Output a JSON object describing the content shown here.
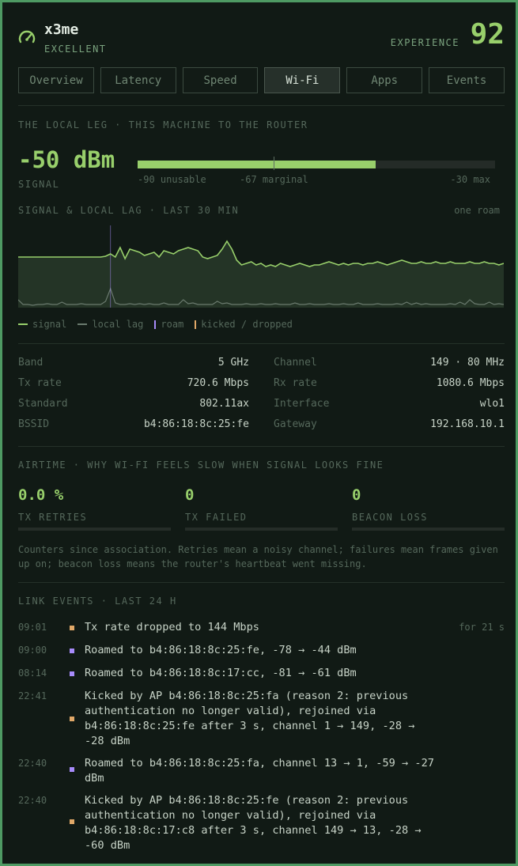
{
  "header": {
    "host": "x3me",
    "status": "EXCELLENT",
    "experience_label": "EXPERIENCE",
    "experience_score": "92",
    "icon": "gauge-icon"
  },
  "tabs": [
    {
      "label": "Overview",
      "active": false
    },
    {
      "label": "Latency",
      "active": false
    },
    {
      "label": "Speed",
      "active": false
    },
    {
      "label": "Wi-Fi",
      "active": true
    },
    {
      "label": "Apps",
      "active": false
    },
    {
      "label": "Events",
      "active": false
    }
  ],
  "signal": {
    "section_title": "THE LOCAL LEG · THIS MACHINE TO THE ROUTER",
    "value": "-50 dBm",
    "label": "SIGNAL",
    "level_dbm": -50,
    "scale_min_dbm": -90,
    "scale_max_dbm": -30,
    "marginal_dbm": -67,
    "scale_labels": {
      "min": "-90 unusable",
      "mid": "-67 marginal",
      "max": "-30 max"
    }
  },
  "chart": {
    "title": "SIGNAL & LOCAL LAG · LAST 30 MIN",
    "note": "one roam",
    "legend": {
      "signal": "signal",
      "lag": "local lag",
      "roam": "roam",
      "kicked": "kicked / dropped"
    },
    "colors": {
      "signal": "#98cf6b",
      "lag": "#6a7a6e",
      "roam": "#a78bfa",
      "kicked": "#e0a868"
    }
  },
  "chart_data": {
    "type": "area",
    "series": [
      {
        "name": "signal",
        "values": [
          60,
          60,
          60,
          60,
          60,
          60,
          60,
          60,
          60,
          60,
          60,
          60,
          60,
          60,
          60,
          60,
          60,
          60,
          61,
          64,
          60,
          72,
          58,
          70,
          68,
          66,
          62,
          64,
          66,
          60,
          68,
          66,
          64,
          68,
          70,
          72,
          70,
          68,
          60,
          58,
          60,
          62,
          70,
          80,
          70,
          56,
          50,
          52,
          54,
          50,
          52,
          48,
          50,
          48,
          52,
          50,
          48,
          50,
          52,
          50,
          48,
          50,
          50,
          52,
          54,
          52,
          50,
          52,
          50,
          52,
          52,
          50,
          52,
          52,
          54,
          52,
          50,
          52,
          54,
          56,
          54,
          52,
          52,
          54,
          52,
          52,
          54,
          52,
          52,
          54,
          52,
          52,
          52,
          54,
          52,
          52,
          54,
          52,
          52,
          50,
          52
        ]
      },
      {
        "name": "local lag",
        "values": [
          8,
          2,
          2,
          1,
          2,
          2,
          3,
          2,
          2,
          5,
          2,
          2,
          2,
          3,
          2,
          2,
          2,
          2,
          6,
          22,
          4,
          2,
          2,
          3,
          2,
          3,
          2,
          3,
          2,
          2,
          4,
          2,
          2,
          2,
          8,
          3,
          4,
          2,
          2,
          2,
          2,
          6,
          3,
          4,
          2,
          2,
          2,
          3,
          2,
          2,
          3,
          2,
          2,
          3,
          2,
          2,
          2,
          4,
          2,
          2,
          3,
          2,
          2,
          2,
          3,
          2,
          2,
          3,
          2,
          2,
          4,
          2,
          2,
          2,
          3,
          2,
          2,
          2,
          3,
          2,
          5,
          2,
          4,
          2,
          3,
          2,
          2,
          2,
          2,
          3,
          2,
          5,
          2,
          8,
          3,
          2,
          2,
          5,
          2,
          3,
          2
        ]
      }
    ],
    "roam_markers": [
      19
    ],
    "ylim": [
      -90,
      -30
    ]
  },
  "stats": {
    "rows": [
      {
        "k1": "Band",
        "v1": "5 GHz",
        "k2": "Channel",
        "v2": "149 · 80 MHz"
      },
      {
        "k1": "Tx rate",
        "v1": "720.6 Mbps",
        "k2": "Rx rate",
        "v2": "1080.6 Mbps"
      },
      {
        "k1": "Standard",
        "v1": "802.11ax",
        "k2": "Interface",
        "v2": "wlo1"
      },
      {
        "k1": "BSSID",
        "v1": "b4:86:18:8c:25:fe",
        "k2": "Gateway",
        "v2": "192.168.10.1"
      }
    ]
  },
  "airtime": {
    "title": "AIRTIME · WHY WI-FI FEELS SLOW WHEN SIGNAL LOOKS FINE",
    "items": [
      {
        "value": "0.0 %",
        "label": "TX RETRIES",
        "fill": 0
      },
      {
        "value": "0",
        "label": "TX FAILED",
        "fill": 0
      },
      {
        "value": "0",
        "label": "BEACON LOSS",
        "fill": 0
      }
    ],
    "note": "Counters since association. Retries mean a noisy channel; failures mean frames given up on; beacon loss means the router's heartbeat went missing."
  },
  "events": {
    "title": "LINK EVENTS · LAST 24 H",
    "items": [
      {
        "time": "09:01",
        "kind": "kicked",
        "text": "Tx rate dropped to 144 Mbps",
        "extra": "for 21 s"
      },
      {
        "time": "09:00",
        "kind": "roam",
        "text": "Roamed to b4:86:18:8c:25:fe, -78 → -44 dBm",
        "extra": ""
      },
      {
        "time": "08:14",
        "kind": "roam",
        "text": "Roamed to b4:86:18:8c:17:cc, -81 → -61 dBm",
        "extra": ""
      },
      {
        "time": "22:41",
        "kind": "kicked",
        "text": "Kicked by AP b4:86:18:8c:25:fa (reason 2: previous authentication no longer valid), rejoined via b4:86:18:8c:25:fe after 3 s, channel 1 → 149, -28 → -28 dBm",
        "extra": ""
      },
      {
        "time": "22:40",
        "kind": "roam",
        "text": "Roamed to b4:86:18:8c:25:fa, channel 13 → 1, -59 → -27 dBm",
        "extra": ""
      },
      {
        "time": "22:40",
        "kind": "kicked",
        "text": "Kicked by AP b4:86:18:8c:25:fe (reason 2: previous authentication no longer valid), rejoined via b4:86:18:8c:17:c8 after 3 s, channel 149 → 13, -28 → -60 dBm",
        "extra": ""
      }
    ]
  }
}
